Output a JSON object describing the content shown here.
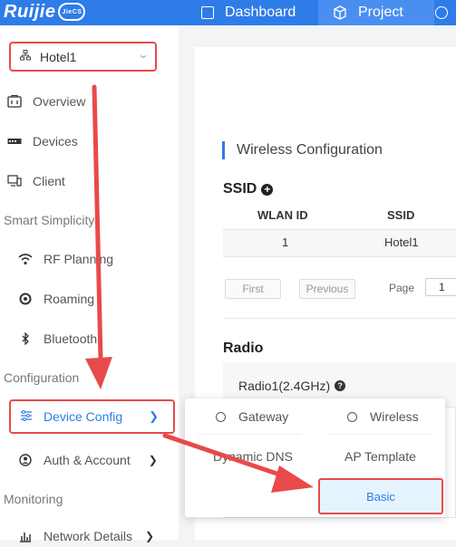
{
  "header": {
    "logo_text": "Ruijie",
    "logo_badge": "JieCS",
    "tabs": [
      {
        "label": "Dashboard",
        "icon": "dashboard-icon"
      },
      {
        "label": "Project",
        "icon": "cube-icon",
        "active": true
      }
    ],
    "accent_color": "#2e7ce8"
  },
  "sidebar": {
    "project_select": {
      "value": "Hotel1",
      "icon": "network-tree-icon"
    },
    "items": [
      {
        "label": "Overview",
        "icon": "overview-icon"
      },
      {
        "label": "Devices",
        "icon": "devices-icon"
      },
      {
        "label": "Client",
        "icon": "client-icon"
      }
    ],
    "sections": [
      {
        "title": "Smart Simplicity",
        "items": [
          {
            "label": "RF Planning",
            "icon": "wifi-icon"
          },
          {
            "label": "Roaming",
            "icon": "roaming-icon"
          },
          {
            "label": "Bluetooth",
            "icon": "bluetooth-icon"
          }
        ]
      },
      {
        "title": "Configuration",
        "items": [
          {
            "label": "Device Config",
            "icon": "sliders-icon",
            "active": true
          },
          {
            "label": "Auth & Account",
            "icon": "user-circle-icon"
          }
        ]
      },
      {
        "title": "Monitoring",
        "items": [
          {
            "label": "Network Details",
            "icon": "chart-icon"
          }
        ]
      }
    ]
  },
  "main": {
    "title": "Wireless Configuration",
    "ssid": {
      "heading": "SSID",
      "columns": [
        "WLAN ID",
        "SSID"
      ],
      "rows": [
        [
          "1",
          "Hotel1"
        ]
      ],
      "pagination": {
        "first": "First",
        "previous": "Previous",
        "page_label": "Page",
        "page_value": "1"
      }
    },
    "radio": {
      "heading": "Radio",
      "radio1_label": "Radio1(2.4GHz)"
    }
  },
  "dropdown": {
    "items": [
      "Gateway",
      "Wireless",
      "Dynamic DNS",
      "AP Template",
      "Basic"
    ]
  },
  "annotation_color": "#e84a4a"
}
